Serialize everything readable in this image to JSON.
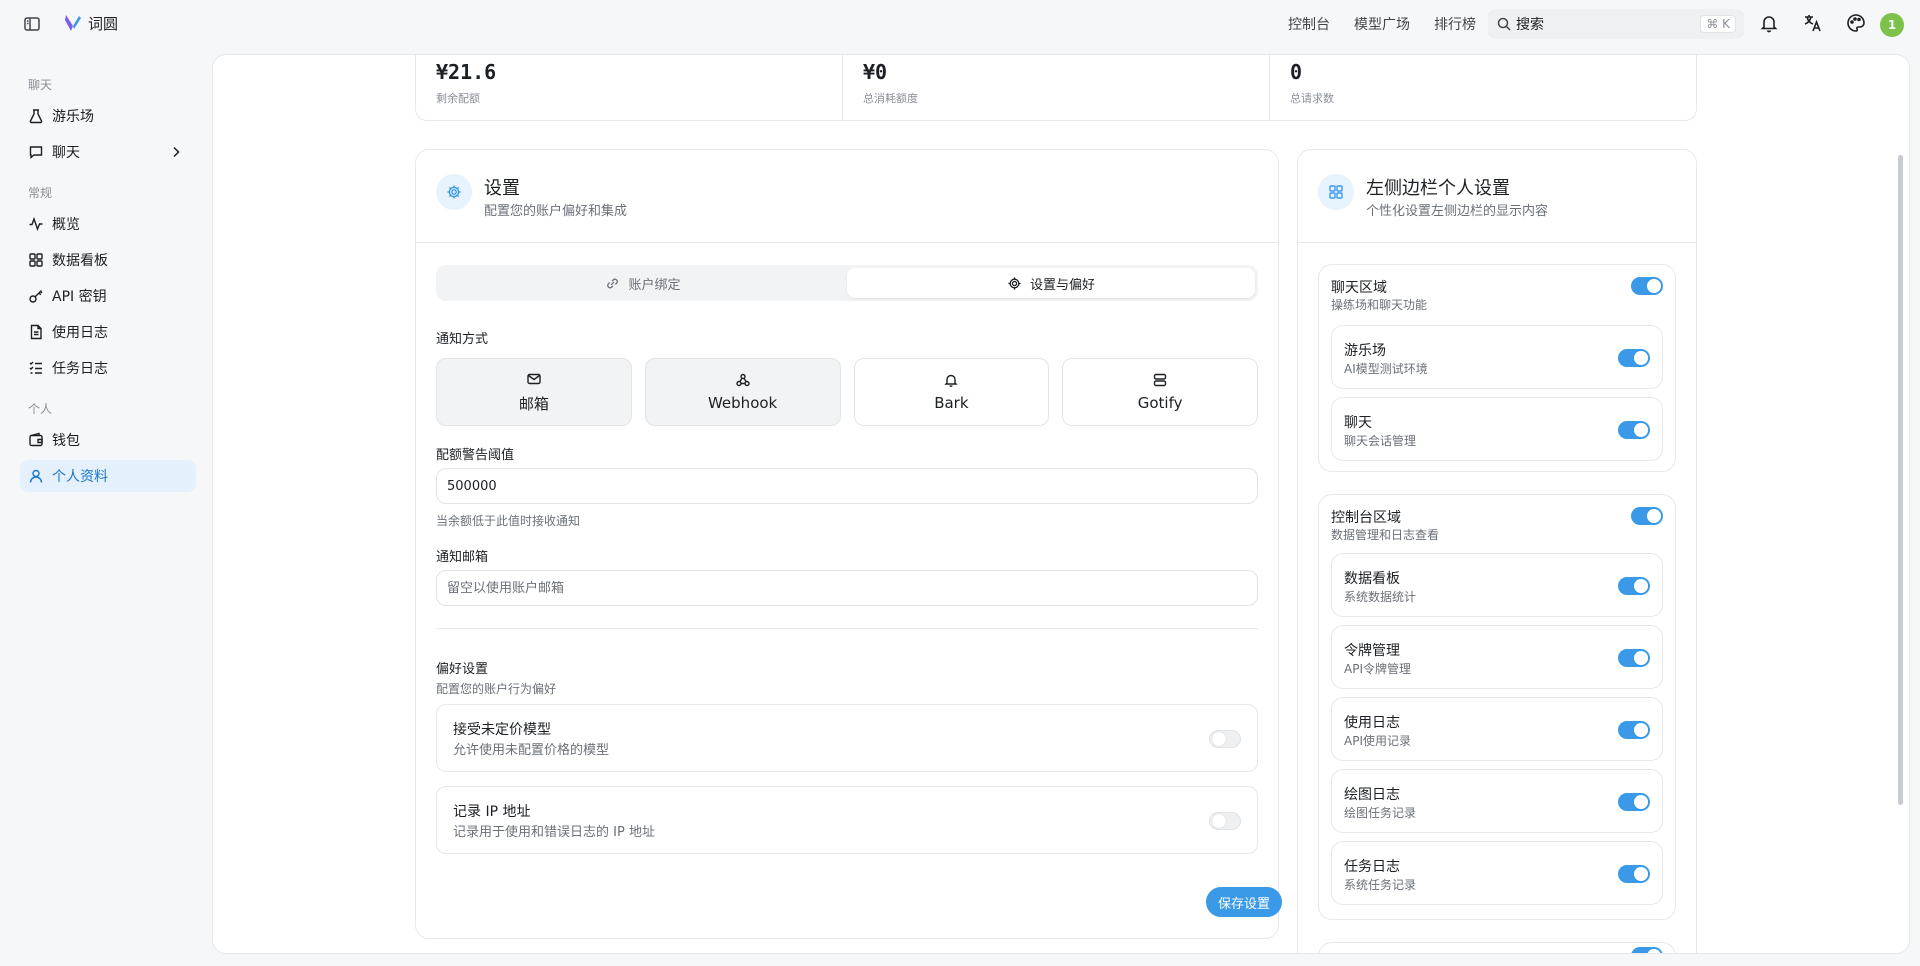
{
  "header": {
    "app_title": "词圆",
    "nav": [
      "控制台",
      "模型广场",
      "排行榜"
    ],
    "search_placeholder": "搜索",
    "search_shortcut": "⌘ K",
    "avatar_text": "1"
  },
  "sidebar": {
    "sections": {
      "chat": "聊天",
      "general": "常规",
      "personal": "个人"
    },
    "items": [
      {
        "label": "游乐场",
        "icon": "flask-icon"
      },
      {
        "label": "聊天",
        "icon": "chat-bubble-icon"
      },
      {
        "label": "概览",
        "icon": "activity-icon"
      },
      {
        "label": "数据看板",
        "icon": "dashboard-icon"
      },
      {
        "label": "API 密钥",
        "icon": "key-icon"
      },
      {
        "label": "使用日志",
        "icon": "file-text-icon"
      },
      {
        "label": "任务日志",
        "icon": "list-check-icon"
      },
      {
        "label": "钱包",
        "icon": "wallet-icon"
      },
      {
        "label": "个人资料",
        "icon": "user-icon"
      }
    ],
    "active_item": "个人资料"
  },
  "stats": [
    {
      "value": "¥21.6",
      "label": "剩余配额"
    },
    {
      "value": "¥0",
      "label": "总消耗额度"
    },
    {
      "value": "0",
      "label": "总请求数"
    }
  ],
  "settings": {
    "title": "设置",
    "subtitle": "配置您的账户偏好和集成",
    "tabs": [
      "账户绑定",
      "设置与偏好"
    ],
    "active_tab": "设置与偏好",
    "notify_label": "通知方式",
    "notify_options": [
      "邮箱",
      "Webhook",
      "Bark",
      "Gotify"
    ],
    "selected_notify": [
      "邮箱",
      "Webhook"
    ],
    "threshold_label": "配额警告阈值",
    "threshold_value": "500000",
    "threshold_hint": "当余额低于此值时接收通知",
    "email_label": "通知邮箱",
    "email_placeholder": "留空以使用账户邮箱",
    "pref_title": "偏好设置",
    "pref_subtitle": "配置您的账户行为偏好",
    "prefs": [
      {
        "title": "接受未定价模型",
        "desc": "允许使用未配置价格的模型",
        "enabled": false
      },
      {
        "title": "记录 IP 地址",
        "desc": "记录用于使用和错误日志的 IP 地址",
        "enabled": false
      }
    ],
    "save_label": "保存设置"
  },
  "sidebar_settings": {
    "title": "左侧边栏个人设置",
    "subtitle": "个性化设置左侧边栏的显示内容",
    "groups": [
      {
        "title": "聊天区域",
        "desc": "操练场和聊天功能",
        "enabled": true,
        "items": [
          {
            "title": "游乐场",
            "desc": "AI模型测试环境",
            "enabled": true
          },
          {
            "title": "聊天",
            "desc": "聊天会话管理",
            "enabled": true
          }
        ]
      },
      {
        "title": "控制台区域",
        "desc": "数据管理和日志查看",
        "enabled": true,
        "items": [
          {
            "title": "数据看板",
            "desc": "系统数据统计",
            "enabled": true
          },
          {
            "title": "令牌管理",
            "desc": "API令牌管理",
            "enabled": true
          },
          {
            "title": "使用日志",
            "desc": "API使用记录",
            "enabled": true
          },
          {
            "title": "绘图日志",
            "desc": "绘图任务记录",
            "enabled": true
          },
          {
            "title": "任务日志",
            "desc": "系统任务记录",
            "enabled": true
          }
        ]
      }
    ]
  },
  "colors": {
    "accent": "#3b9ae8",
    "active_bg": "#e4f1fc",
    "avatar": "#7cc24b"
  }
}
